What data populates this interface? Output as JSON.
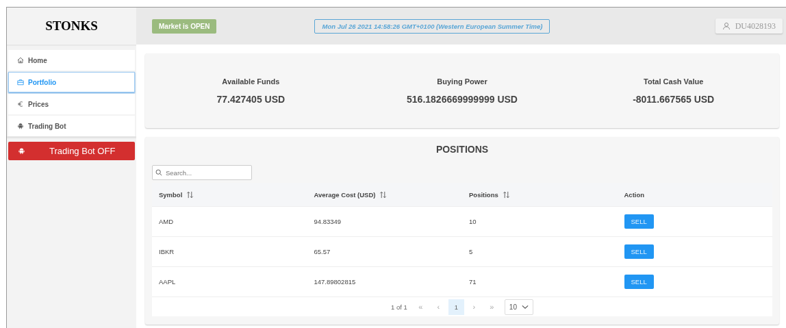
{
  "brand": "STONKS",
  "nav": [
    {
      "label": "Home",
      "kind": "home",
      "selected": false
    },
    {
      "label": "Portfolio",
      "kind": "briefcase",
      "selected": true
    },
    {
      "label": "Prices",
      "kind": "euro",
      "selected": false
    },
    {
      "label": "Trading Bot",
      "kind": "robot",
      "selected": false
    }
  ],
  "bot_toggle": {
    "label": "Trading Bot OFF",
    "on": false
  },
  "header": {
    "market_status": {
      "label": "Market is OPEN",
      "open": true
    },
    "datetime": "Mon Jul 26 2021 14:58:26 GMT+0100 (Western European Summer Time)",
    "account": "DU4028193"
  },
  "funds": [
    {
      "label": "Available Funds",
      "value": "77.427405 USD"
    },
    {
      "label": "Buying Power",
      "value": "516.1826669999999 USD"
    },
    {
      "label": "Total Cash Value",
      "value": "-8011.667565 USD"
    }
  ],
  "positions": {
    "title": "POSITIONS",
    "search": {
      "placeholder": "Search..."
    },
    "columns": [
      {
        "label": "Symbol",
        "sortable": true
      },
      {
        "label": "Average Cost (USD)",
        "sortable": true
      },
      {
        "label": "Positions",
        "sortable": true
      },
      {
        "label": "Action",
        "sortable": false
      }
    ],
    "rows": [
      {
        "symbol": "AMD",
        "average_cost": "94.83349",
        "positions": "10",
        "action": "SELL"
      },
      {
        "symbol": "IBKR",
        "average_cost": "65.57",
        "positions": "5",
        "action": "SELL"
      },
      {
        "symbol": "AAPL",
        "average_cost": "147.89802815",
        "positions": "71",
        "action": "SELL"
      }
    ],
    "pagination": {
      "summary": "1 of 1",
      "first": "«",
      "prev": "‹",
      "pages": [
        {
          "label": "1",
          "selected": true
        }
      ],
      "next": "›",
      "last": "»",
      "page_size": "10"
    }
  }
}
